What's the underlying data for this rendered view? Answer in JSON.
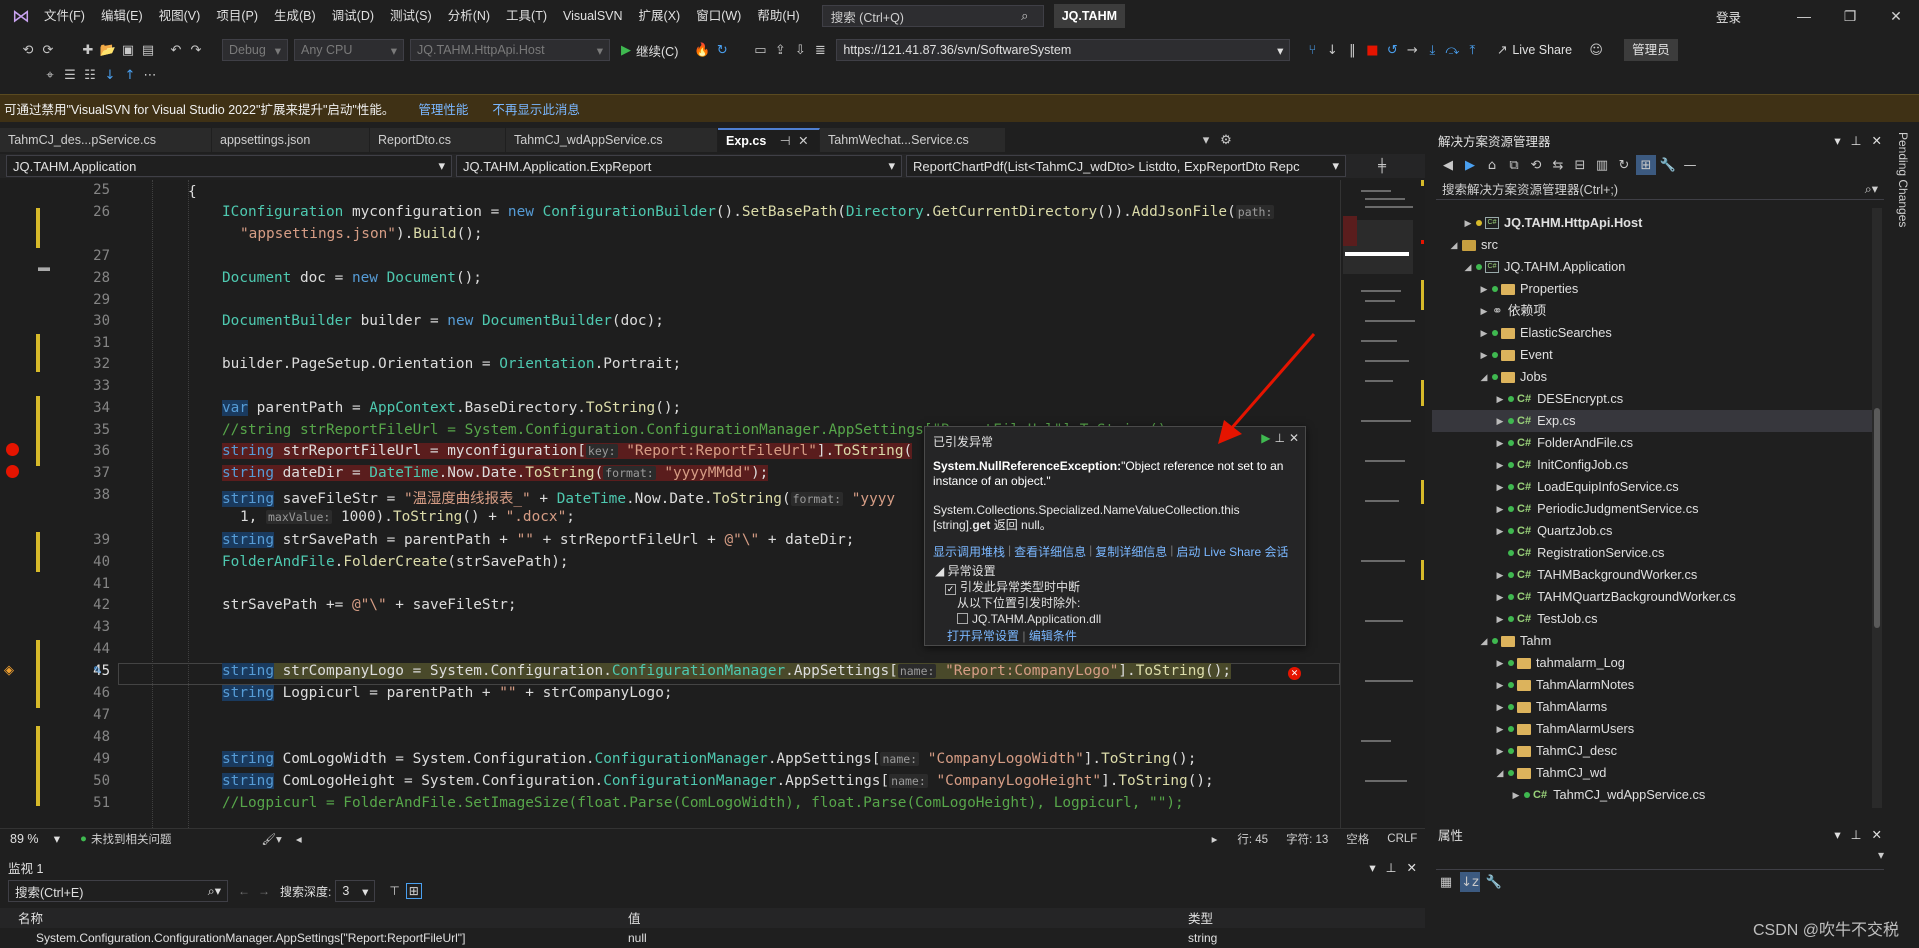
{
  "menubar": {
    "items": [
      "文件(F)",
      "编辑(E)",
      "视图(V)",
      "项目(P)",
      "生成(B)",
      "调试(D)",
      "测试(S)",
      "分析(N)",
      "工具(T)",
      "VisualSVN",
      "扩展(X)",
      "窗口(W)",
      "帮助(H)"
    ],
    "search_placeholder": "搜索 (Ctrl+Q)",
    "solution_name": "JQ.TAHM",
    "login": "登录"
  },
  "toolbar": {
    "config": "Debug",
    "platform": "Any CPU",
    "startup_project": "JQ.TAHM.HttpApi.Host",
    "continue_label": "继续(C)",
    "svn_url": "https://121.41.87.36/svn/SoftwareSystem",
    "live_share": "Live Share",
    "admin": "管理员"
  },
  "infobar": {
    "message": "可通过禁用\"VisualSVN for Visual Studio 2022\"扩展来提升\"启动\"性能。",
    "link1": "管理性能",
    "link2": "不再显示此消息"
  },
  "doc_tabs": [
    {
      "label": "TahmCJ_des...pService.cs",
      "active": false
    },
    {
      "label": "appsettings.json",
      "active": false
    },
    {
      "label": "ReportDto.cs",
      "active": false
    },
    {
      "label": "TahmCJ_wdAppService.cs",
      "active": false
    },
    {
      "label": "Exp.cs",
      "active": true
    },
    {
      "label": "TahmWechat...Service.cs",
      "active": false
    }
  ],
  "navbar": {
    "project": "JQ.TAHM.Application",
    "class": "JQ.TAHM.Application.ExpReport",
    "member": "ReportChartPdf(List<TahmCJ_wdDto> Listdto, ExpReportDto Repc"
  },
  "editor": {
    "line_numbers": [
      "25",
      "26",
      "",
      "27",
      "28",
      "29",
      "30",
      "31",
      "32",
      "33",
      "34",
      "35",
      "36",
      "37",
      "38",
      "",
      "39",
      "40",
      "41",
      "42",
      "43",
      "44",
      "45",
      "46",
      "47",
      "48",
      "49",
      "50",
      "51"
    ],
    "current_line": "45"
  },
  "exception": {
    "title": "已引发异常",
    "type": "System.NullReferenceException:",
    "message": "\"Object reference not set to an instance of an object.\"",
    "detail_prefix": "System.Collections.Specialized.NameValueCollection.this [string].",
    "detail_bold": "get",
    "detail_suffix": " 返回 null。",
    "links": [
      "显示调用堆栈",
      "查看详细信息",
      "复制详细信息",
      "启动 Live Share 会话"
    ],
    "settings_header": "异常设置",
    "break_label": "引发此异常类型时中断",
    "except_label": "从以下位置引发时除外:",
    "module": "JQ.TAHM.Application.dll",
    "open_settings": "打开异常设置",
    "edit_conditions": "编辑条件"
  },
  "status": {
    "zoom": "89 %",
    "issues": "未找到相关问题",
    "line": "行: 45",
    "col": "字符: 13",
    "space": "空格",
    "eol": "CRLF"
  },
  "watch": {
    "title": "监视 1",
    "search_placeholder": "搜索(Ctrl+E)",
    "depth_label": "搜索深度:",
    "depth_value": "3",
    "col_name": "名称",
    "col_value": "值",
    "col_type": "类型",
    "rows": [
      {
        "name": "System.Configuration.ConfigurationManager.AppSettings[\"Report:ReportFileUrl\"]",
        "value": "null",
        "type": "string"
      }
    ]
  },
  "solution_explorer": {
    "title": "解决方案资源管理器",
    "search_placeholder": "搜索解决方案资源管理器(Ctrl+;)",
    "items": [
      {
        "label": "JQ.TAHM.HttpApi.Host",
        "kind": "proj",
        "bold": true
      },
      {
        "label": "src",
        "kind": "folder"
      },
      {
        "label": "JQ.TAHM.Application",
        "kind": "proj"
      },
      {
        "label": "Properties",
        "kind": "folder"
      },
      {
        "label": "依赖项",
        "kind": "deps"
      },
      {
        "label": "ElasticSearches",
        "kind": "folder"
      },
      {
        "label": "Event",
        "kind": "folder"
      },
      {
        "label": "Jobs",
        "kind": "folder"
      },
      {
        "label": "DESEncrypt.cs",
        "kind": "cs"
      },
      {
        "label": "Exp.cs",
        "kind": "cs",
        "selected": true
      },
      {
        "label": "FolderAndFile.cs",
        "kind": "cs"
      },
      {
        "label": "InitConfigJob.cs",
        "kind": "cs"
      },
      {
        "label": "LoadEquipInfoService.cs",
        "kind": "cs"
      },
      {
        "label": "PeriodicJudgmentService.cs",
        "kind": "cs"
      },
      {
        "label": "QuartzJob.cs",
        "kind": "cs"
      },
      {
        "label": "RegistrationService.cs",
        "kind": "cs"
      },
      {
        "label": "TAHMBackgroundWorker.cs",
        "kind": "cs"
      },
      {
        "label": "TAHMQuartzBackgroundWorker.cs",
        "kind": "cs"
      },
      {
        "label": "TestJob.cs",
        "kind": "cs"
      },
      {
        "label": "Tahm",
        "kind": "folder"
      },
      {
        "label": "tahmalarm_Log",
        "kind": "folder"
      },
      {
        "label": "TahmAlarmNotes",
        "kind": "folder"
      },
      {
        "label": "TahmAlarms",
        "kind": "folder"
      },
      {
        "label": "TahmAlarmUsers",
        "kind": "folder"
      },
      {
        "label": "TahmCJ_desc",
        "kind": "folder"
      },
      {
        "label": "TahmCJ_wd",
        "kind": "folder"
      },
      {
        "label": "TahmCJ_wdAppService.cs",
        "kind": "cs"
      }
    ]
  },
  "properties": {
    "title": "属性"
  },
  "pending_changes": "Pending Changes",
  "watermark": "CSDN @吹牛不交税"
}
